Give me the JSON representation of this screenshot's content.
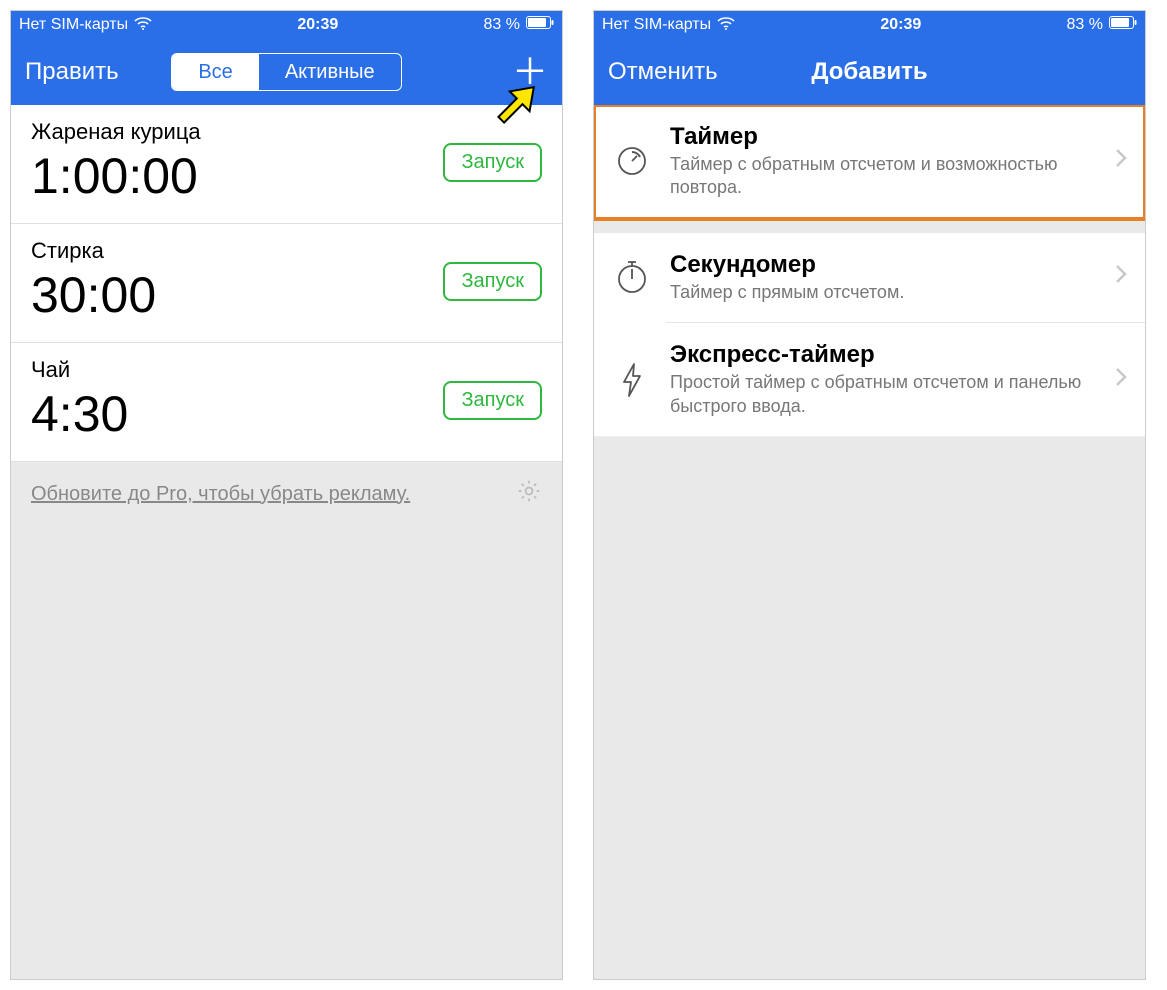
{
  "status": {
    "carrier": "Нет SIM-карты",
    "time": "20:39",
    "battery": "83 %"
  },
  "screen1": {
    "nav": {
      "edit": "Править",
      "seg_all": "Все",
      "seg_active": "Активные"
    },
    "timers": [
      {
        "name": "Жареная курица",
        "time": "1:00:00",
        "start": "Запуск"
      },
      {
        "name": "Стирка",
        "time": "30:00",
        "start": "Запуск"
      },
      {
        "name": "Чай",
        "time": "4:30",
        "start": "Запуск"
      }
    ],
    "upgrade": "Обновите до Pro, чтобы убрать рекламу."
  },
  "screen2": {
    "nav": {
      "cancel": "Отменить",
      "title": "Добавить"
    },
    "options": [
      {
        "title": "Таймер",
        "desc": "Таймер с обратным отсчетом и возможностью повтора."
      },
      {
        "title": "Секундомер",
        "desc": "Таймер с прямым отсчетом."
      },
      {
        "title": "Экспресс-таймер",
        "desc": "Простой таймер с обратным отсчетом и панелью быстрого ввода."
      }
    ]
  }
}
